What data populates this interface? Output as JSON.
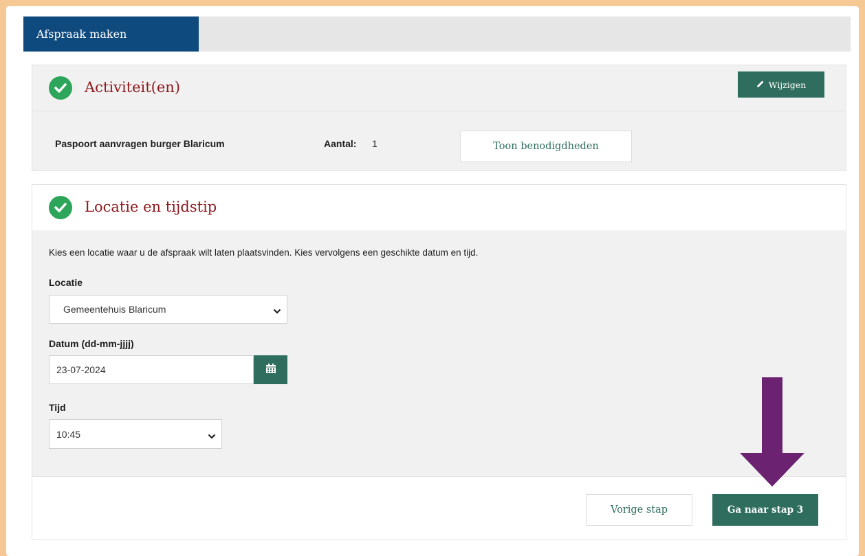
{
  "colors": {
    "background": "#f6c994",
    "tab_active": "#0e4a7e",
    "accent_green": "#2f6e5e",
    "check_green": "#2da55a",
    "heading_red": "#8f1b20",
    "arrow_purple": "#6b2270"
  },
  "tabs": {
    "active_label": "Afspraak maken"
  },
  "activity": {
    "title": "Activiteit(en)",
    "edit_label": "Wijzigen",
    "edit_icon": "pencil-icon",
    "item_name": "Paspoort aanvragen burger Blaricum",
    "count_label": "Aantal:",
    "count_value": "1",
    "requirements_button": "Toon benodigdheden"
  },
  "location": {
    "title": "Locatie en tijdstip",
    "intro": "Kies een locatie waar u de afspraak wilt laten plaatsvinden. Kies vervolgens een geschikte datum en tijd.",
    "location_label": "Locatie",
    "location_value": "Gemeentehuis Blaricum",
    "date_label": "Datum (dd-mm-jjjj)",
    "date_value": "23-07-2024",
    "calendar_icon": "calendar-icon",
    "time_label": "Tijd",
    "time_value": "10:45"
  },
  "footer": {
    "prev_button": "Vorige stap",
    "next_button": "Ga naar stap 3"
  }
}
